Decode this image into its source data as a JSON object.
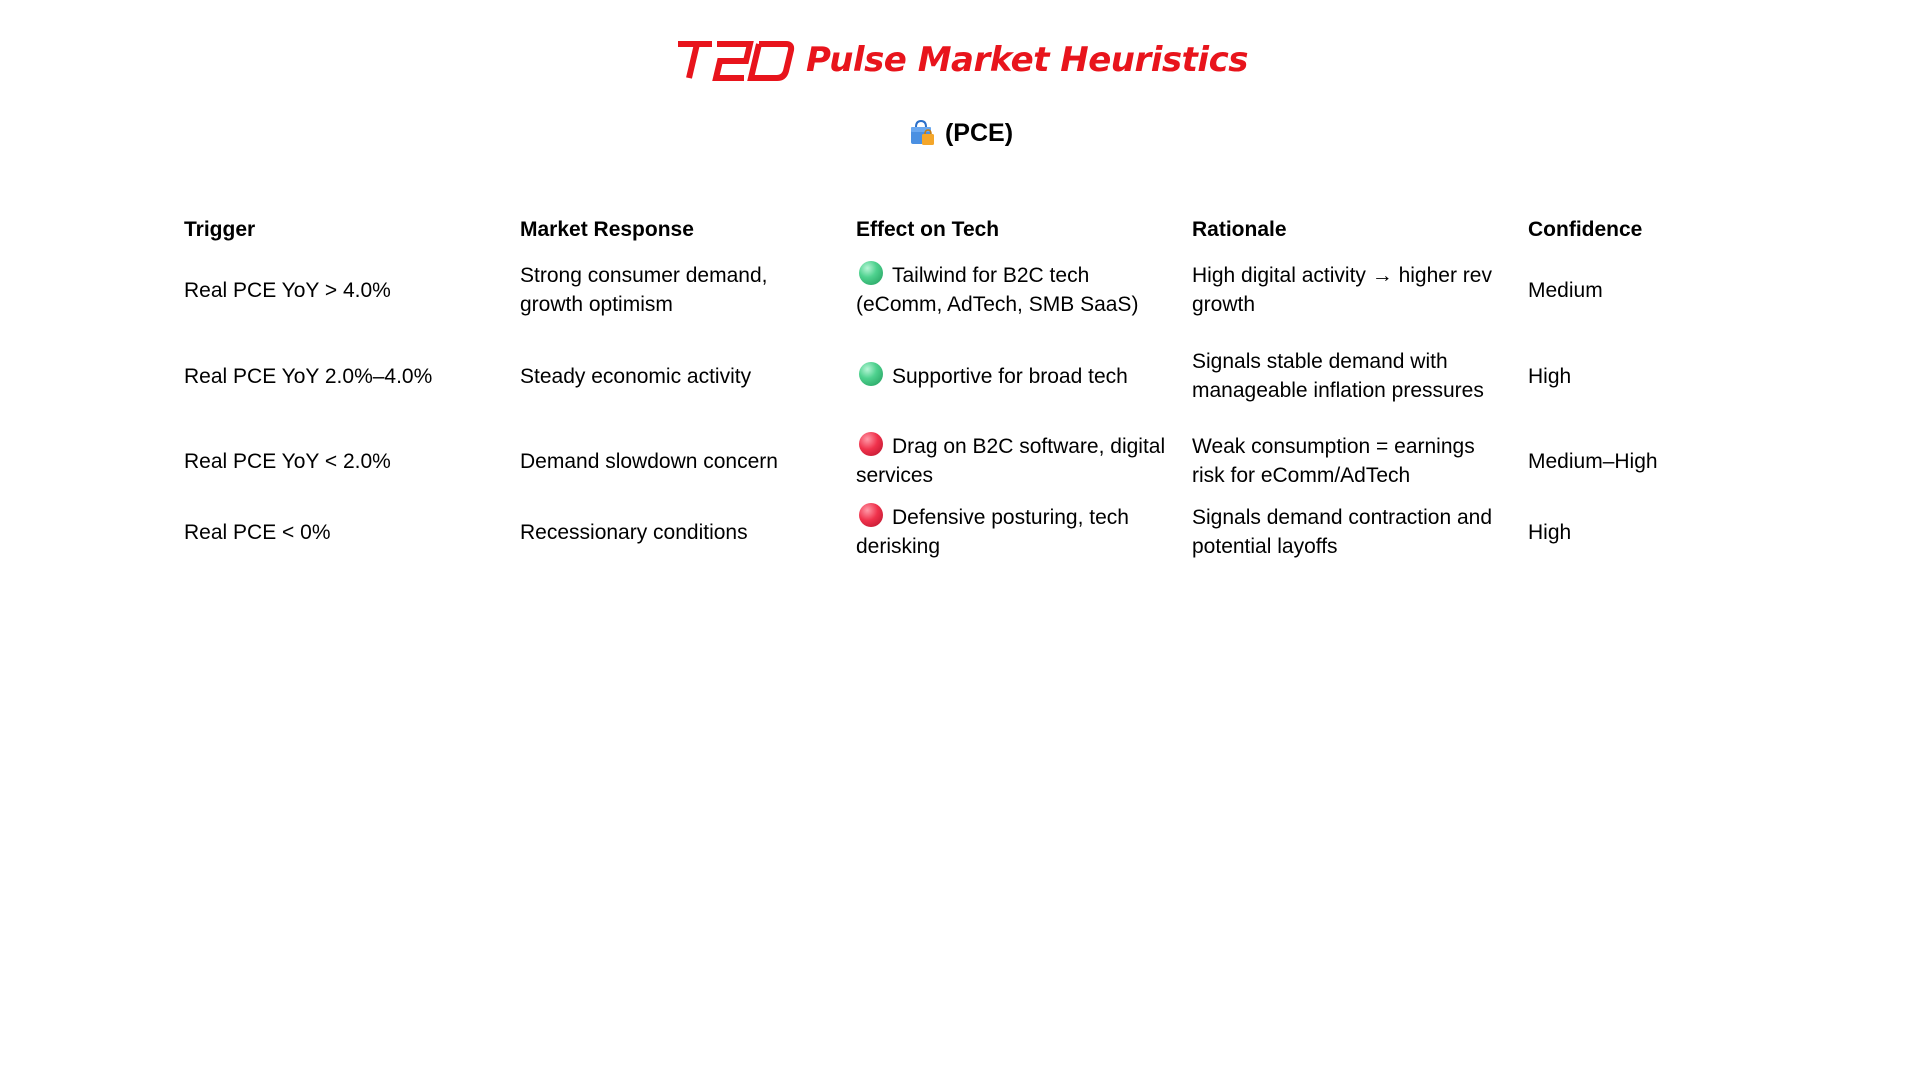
{
  "header": {
    "logo_text": "T2D",
    "title": "Pulse Market Heuristics",
    "brand_color": "#e8141c"
  },
  "subtitle": {
    "icon": "shopping-bag-icon",
    "text": "(PCE)"
  },
  "table": {
    "columns": [
      "Trigger",
      "Market Response",
      "Effect on Tech",
      "Rationale",
      "Confidence"
    ],
    "rows": [
      {
        "trigger": "Real PCE YoY > 4.0%",
        "response": "Strong consumer demand, growth optimism",
        "effect_icon": "green-circle-icon",
        "effect": "Tailwind for B2C tech (eComm, AdTech, SMB SaaS)",
        "rationale": "High digital activity → higher rev growth",
        "confidence": "Medium"
      },
      {
        "trigger": "Real PCE YoY 2.0%–4.0%",
        "response": "Steady economic activity",
        "effect_icon": "green-circle-icon",
        "effect": "Supportive for broad tech",
        "rationale": "Signals stable demand with manageable inflation pressures",
        "confidence": "High"
      },
      {
        "trigger": "Real PCE YoY < 2.0%",
        "response": "Demand slowdown concern",
        "effect_icon": "red-circle-icon",
        "effect": "Drag on B2C software, digital services",
        "rationale": "Weak consumption = earnings risk for eComm/AdTech",
        "confidence": "Medium–High"
      },
      {
        "trigger": "Real PCE < 0%",
        "response": "Recessionary conditions",
        "effect_icon": "red-circle-icon",
        "effect": "Defensive posturing, tech derisking",
        "rationale": "Signals demand contraction and potential layoffs",
        "confidence": "High"
      }
    ]
  }
}
